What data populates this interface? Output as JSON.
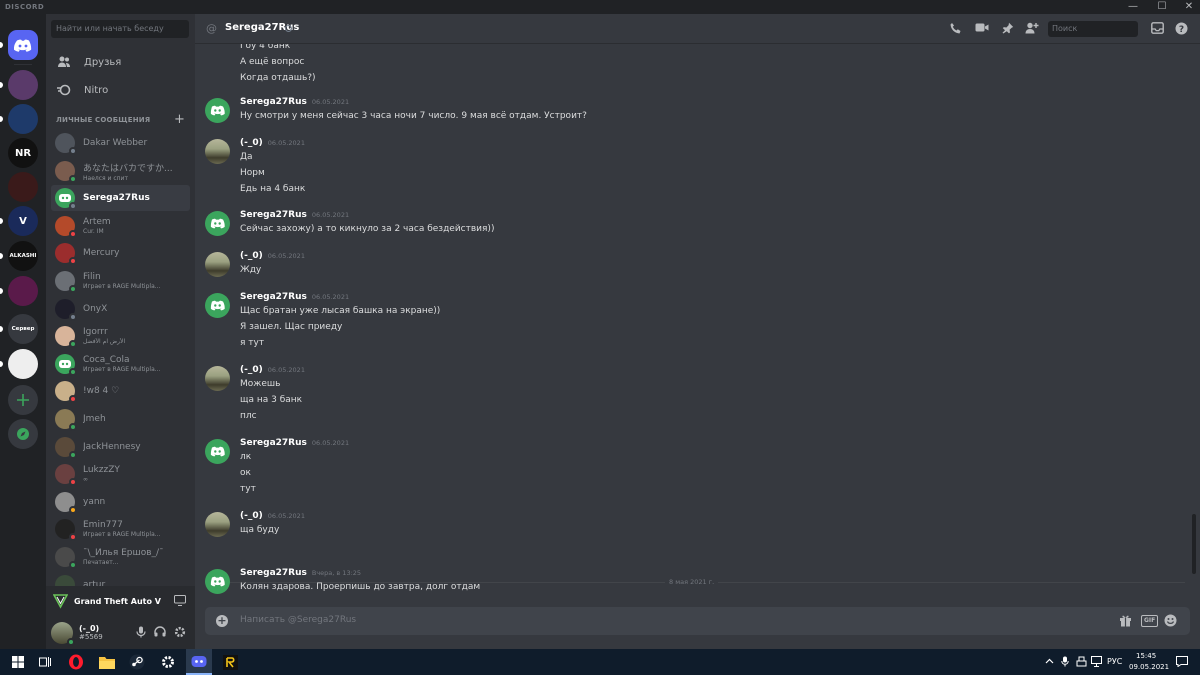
{
  "app": {
    "brand": "DISCORD",
    "window_controls": [
      "—",
      "☐",
      "✕"
    ]
  },
  "sidebar": {
    "search_placeholder": "Найти или начать беседу",
    "nav": [
      {
        "label": "Друзья",
        "icon": "friends-icon"
      },
      {
        "label": "Nitro",
        "icon": "nitro-icon"
      }
    ],
    "dm_header": "ЛИЧНЫЕ СООБЩЕНИЯ",
    "dms": [
      {
        "name": "Dakar Webber",
        "sub": "",
        "status": "off",
        "color": "#4f545c"
      },
      {
        "name": "あなたはバカですか...",
        "sub": "Наелся и спит",
        "status": "on",
        "color": "#7a5c4e"
      },
      {
        "name": "Serega27Rus",
        "sub": "",
        "status": "off",
        "color": "#3ba55d",
        "active": true
      },
      {
        "name": "Artem",
        "sub": "Cur. IM",
        "status": "dnd",
        "color": "#b44a2a"
      },
      {
        "name": "Mercury",
        "sub": "",
        "status": "dnd",
        "color": "#9b2d2d"
      },
      {
        "name": "Filin",
        "sub": "Играет в RAGE Multipla...",
        "status": "on",
        "color": "#6b6f75"
      },
      {
        "name": "OnyX",
        "sub": "",
        "status": "off",
        "color": "#1e1e2a"
      },
      {
        "name": "Igorrr",
        "sub": "الأرض ام الأفضل",
        "status": "on",
        "color": "#d8b49a"
      },
      {
        "name": "Coca_Cola",
        "sub": "Играет в RAGE Multipla...",
        "status": "on",
        "color": "#3ba55d"
      },
      {
        "name": "!w8 4 ♡",
        "sub": "",
        "status": "dnd",
        "color": "#c9b08a"
      },
      {
        "name": "Jmeh",
        "sub": "",
        "status": "on",
        "color": "#8a7a55"
      },
      {
        "name": "JackHennesy",
        "sub": "",
        "status": "on",
        "color": "#5a4a3a"
      },
      {
        "name": "LukzzZY",
        "sub": "∞",
        "status": "dnd",
        "color": "#6a4040"
      },
      {
        "name": "yann",
        "sub": "",
        "status": "idle",
        "color": "#8e8e8e"
      },
      {
        "name": "Emin777",
        "sub": "Играет в RAGE Multipla...",
        "status": "dnd",
        "color": "#222"
      },
      {
        "name": "¯\\_Илья Ершов_/¯",
        "sub": "Печатает...",
        "status": "on",
        "color": "#4a4a4a"
      },
      {
        "name": "artur",
        "sub": "",
        "status": "on",
        "color": "#3a4a3a"
      }
    ],
    "activity": "Grand Theft Auto V",
    "user": {
      "name": "(-_0)",
      "tag": "#5569"
    }
  },
  "guilds": [
    {
      "label": "",
      "color": "#5865f2"
    },
    {
      "label": "",
      "color": "#5a3a6a"
    },
    {
      "label": "",
      "color": "#1e3a6a"
    },
    {
      "label": "NR",
      "color": "#111"
    },
    {
      "label": "",
      "color": "#3a1a1a"
    },
    {
      "label": "V",
      "color": "#1a2a5a"
    },
    {
      "label": "ALKASHI",
      "color": "#111"
    },
    {
      "label": "",
      "color": "#5a1a4a"
    },
    {
      "label": "Сервер",
      "color": "#36393f"
    },
    {
      "label": "",
      "color": "#eee"
    }
  ],
  "header": {
    "name": "Serega27Rus",
    "search_placeholder": "Поиск"
  },
  "chat": {
    "top_lines": [
      "Гоу 4 банк",
      "А ещё вопрос",
      "Когда отдашь?)"
    ],
    "groups": [
      {
        "author": "Serega27Rus",
        "time": "06.05.2021",
        "bot": true,
        "lines": [
          "Ну смотри у меня сейчас 3 часа ночи 7 число. 9 мая всё отдам. Устроит?"
        ]
      },
      {
        "author": "(-_0)",
        "time": "06.05.2021",
        "bot": false,
        "lines": [
          "Да",
          "Норм",
          "Едь на 4 банк"
        ]
      },
      {
        "author": "Serega27Rus",
        "time": "06.05.2021",
        "bot": true,
        "lines": [
          "Сейчас захожу) а то кикнуло за 2 часа бездействия))"
        ]
      },
      {
        "author": "(-_0)",
        "time": "06.05.2021",
        "bot": false,
        "lines": [
          "Жду"
        ]
      },
      {
        "author": "Serega27Rus",
        "time": "06.05.2021",
        "bot": true,
        "lines": [
          "Щас братан уже лысая башка на экране))",
          "Я зашел. Щас приеду",
          "я тут"
        ]
      },
      {
        "author": "(-_0)",
        "time": "06.05.2021",
        "bot": false,
        "lines": [
          "Можешь",
          "ща на 3 банк",
          "плс"
        ]
      },
      {
        "author": "Serega27Rus",
        "time": "06.05.2021",
        "bot": true,
        "lines": [
          "лк",
          "ок",
          "тут"
        ]
      },
      {
        "author": "(-_0)",
        "time": "06.05.2021",
        "bot": false,
        "lines": [
          "ща буду"
        ]
      },
      {
        "author": "Serega27Rus",
        "time": "Вчера, в 13:25",
        "bot": true,
        "lines": [
          "Колян здарова. Проерпишь до завтра, долг отдам"
        ]
      }
    ],
    "divider": "8 мая 2021 г.",
    "composer_placeholder": "Написать @Serega27Rus"
  },
  "taskbar": {
    "lang": "РУС",
    "time": "15:45",
    "date": "09.05.2021"
  },
  "colors": {
    "accent": "#5865f2",
    "online": "#3ba55d",
    "dnd": "#ed4245",
    "idle": "#faa81a"
  }
}
